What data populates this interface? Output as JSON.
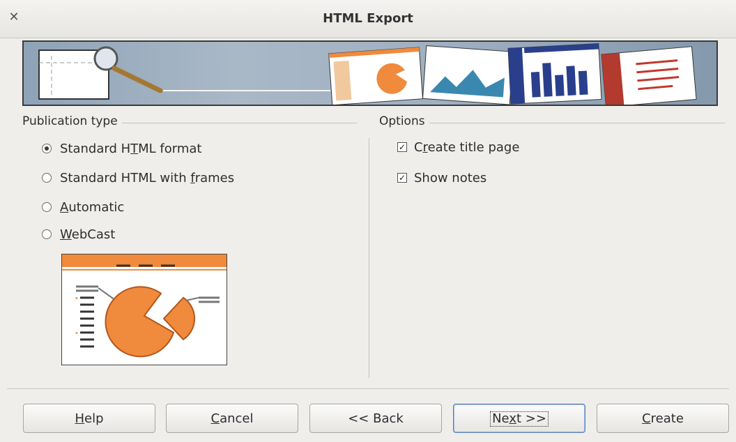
{
  "window": {
    "title": "HTML Export",
    "close_icon": "close-icon"
  },
  "publication": {
    "label": "Publication type",
    "options": [
      {
        "pre": "Standard H",
        "mn": "T",
        "post": "ML format",
        "selected": true
      },
      {
        "pre": "Standard HTML with ",
        "mn": "f",
        "post": "rames",
        "selected": false
      },
      {
        "pre": "",
        "mn": "A",
        "post": "utomatic",
        "selected": false
      },
      {
        "pre": "",
        "mn": "W",
        "post": "ebCast",
        "selected": false
      }
    ]
  },
  "options": {
    "label": "Options",
    "checks": [
      {
        "pre": "C",
        "mn": "r",
        "post": "eate title page",
        "checked": true
      },
      {
        "pre": "Show notes",
        "mn": "",
        "post": "",
        "checked": true
      }
    ]
  },
  "buttons": {
    "help": {
      "mn": "H",
      "post": "elp"
    },
    "cancel": {
      "mn": "C",
      "post": "ancel"
    },
    "back": {
      "label": "<< Back"
    },
    "next": {
      "pre": "Ne",
      "mn": "x",
      "post": "t >>"
    },
    "create": {
      "mn": "C",
      "post": "reate"
    }
  },
  "colors": {
    "accent": "#f08a3c",
    "banner_blue": "#2a3f8c"
  }
}
